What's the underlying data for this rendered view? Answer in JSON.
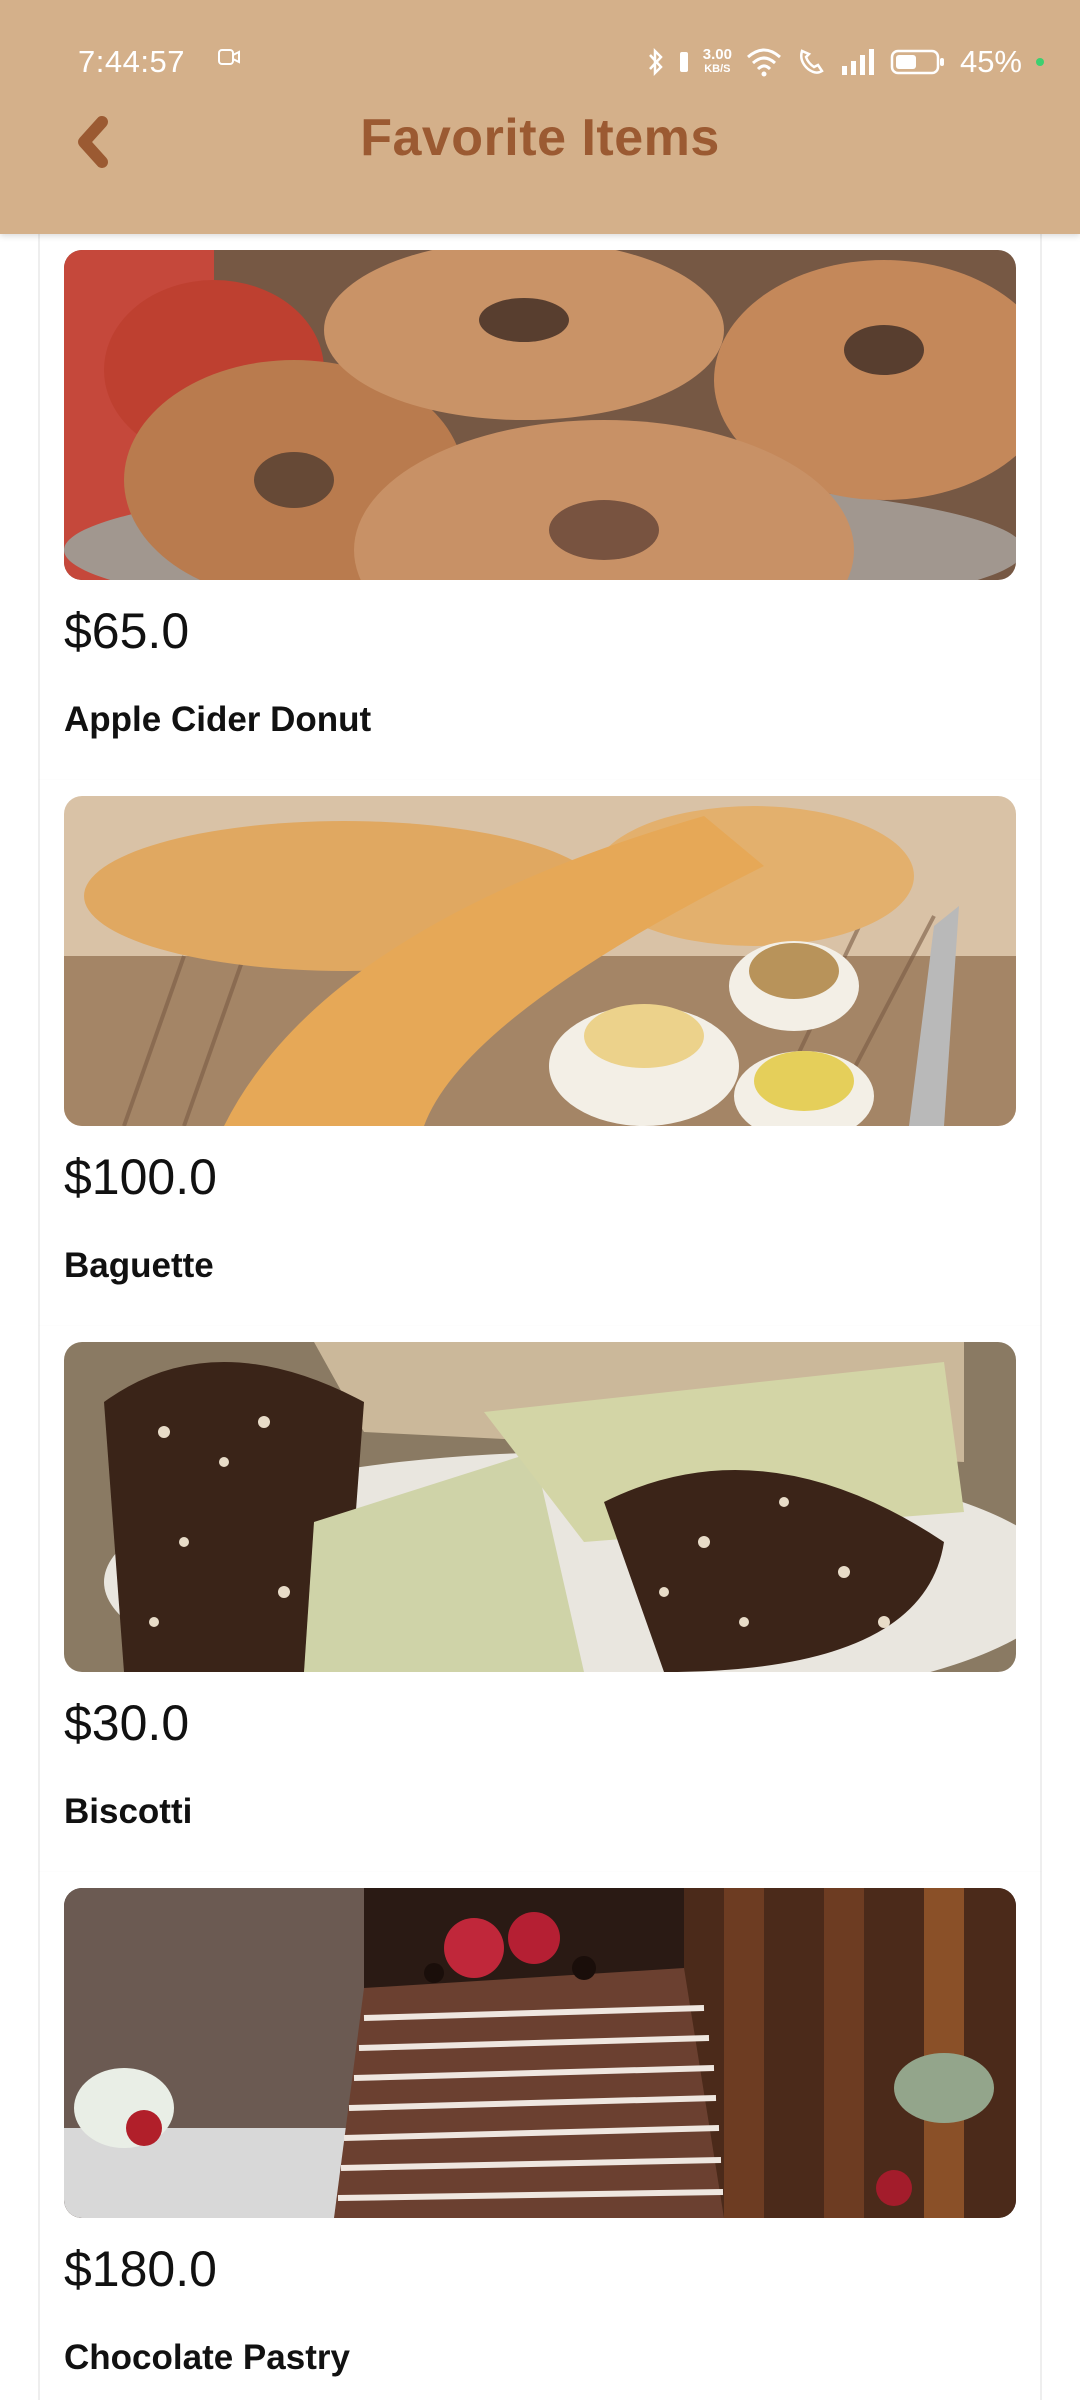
{
  "status_bar": {
    "time": "7:44:57",
    "net_speed_value": "3.00",
    "net_speed_unit": "KB/S",
    "battery_percent": "45%"
  },
  "header": {
    "title": "Favorite Items",
    "back_icon": "back-arrow-icon",
    "background_color": "#d4b08a",
    "title_color": "#9b5a32"
  },
  "items": [
    {
      "price": "$65.0",
      "name": "Apple Cider Donut"
    },
    {
      "price": "$100.0",
      "name": "Baguette"
    },
    {
      "price": "$30.0",
      "name": "Biscotti"
    },
    {
      "price": "$180.0",
      "name": "Chocolate Pastry"
    }
  ]
}
